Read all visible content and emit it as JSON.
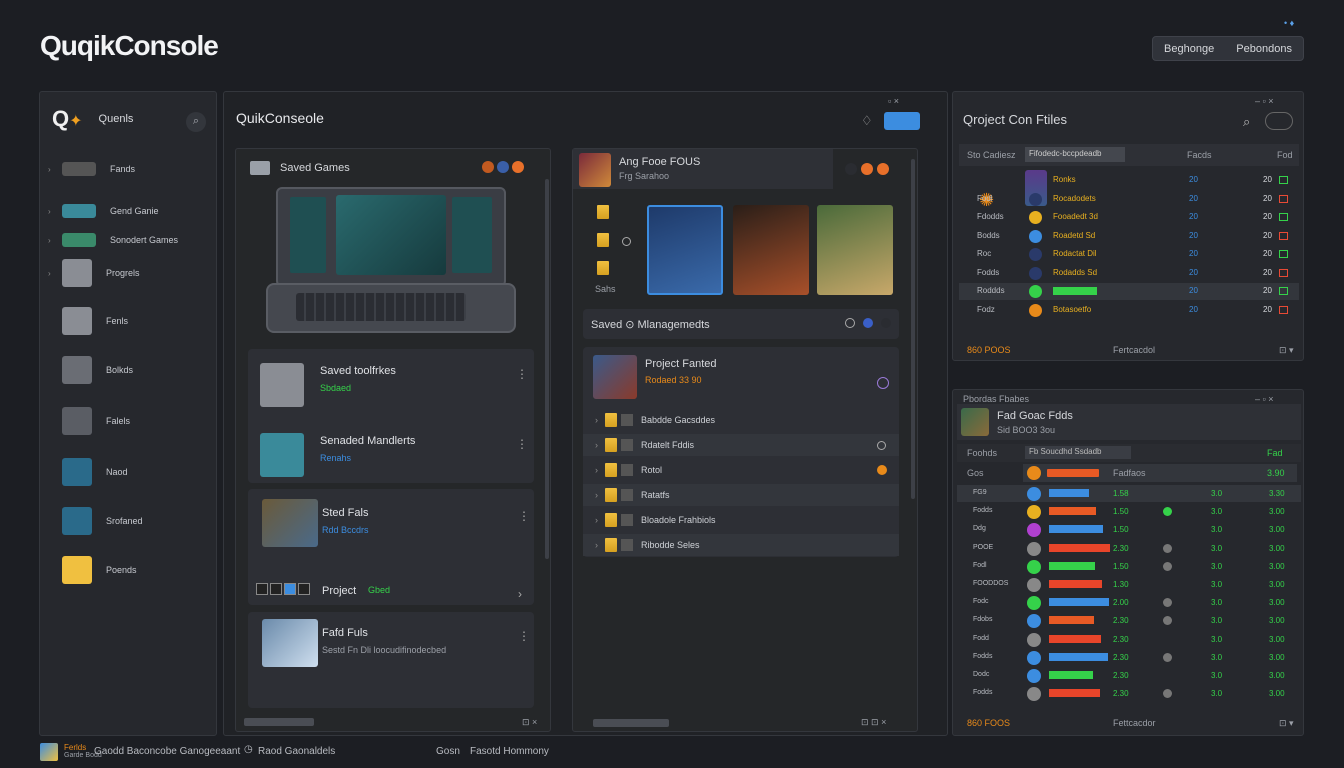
{
  "app": {
    "logo": "QuqikConsole",
    "top_btn1": "Beghonge",
    "top_btn2": "Pebondons",
    "tiny_top": "• ♦"
  },
  "sidebar": {
    "title": "Quenls",
    "items": [
      {
        "label": "Fands"
      },
      {
        "label": "Gend Ganie"
      },
      {
        "label": "Sonodert Games"
      },
      {
        "label": "Progrels"
      },
      {
        "label": "Fenls"
      },
      {
        "label": "Bolkds"
      },
      {
        "label": "Falels"
      },
      {
        "label": "Naod"
      },
      {
        "label": "Srofaned"
      },
      {
        "label": "Poends"
      }
    ]
  },
  "main": {
    "title": "QuikConseole",
    "win_controls": "▫ ×",
    "saved_games": {
      "title": "Saved Games"
    },
    "list": [
      {
        "title": "Saved toolfrkes",
        "sub": "Sbdaed"
      },
      {
        "title": "Senaded Mandlerts",
        "sub": "Renahs"
      },
      {
        "title": "Sted Fals",
        "sub": "Rdd Bccdrs"
      },
      {
        "title": "Project",
        "sub": "Gbed"
      },
      {
        "title": "Fafd Fuls",
        "sub": "Sestd Fn Dli loocudifinodecbed"
      }
    ],
    "footer_icons": "⊡ ×"
  },
  "middle": {
    "header_title": "Ang Fooe FOUS",
    "header_sub": "Frg Sarahoo",
    "folder_label": "Sahs",
    "management": {
      "title": "Saved ⊙ Mlanagemedts"
    },
    "project": {
      "title": "Project Fanted",
      "sub": "Rodaed 33 90"
    },
    "tree": [
      {
        "label": "Babdde Gacsddes"
      },
      {
        "label": "Rdatelt Fddis"
      },
      {
        "label": "Rotol"
      },
      {
        "label": "Ratatfs"
      },
      {
        "label": "Bloadole Frahbiols"
      },
      {
        "label": "Ribodde Seles"
      }
    ],
    "footer_icons": "⊡ ⊡ ×"
  },
  "right_top": {
    "title": "Qroject Con Ftiles",
    "win_controls": "– ▫ ×",
    "search_label": "Sto Cadiesz",
    "search_value": "Fifodedc-bccpdeadb",
    "col_header": "Facds",
    "col_header2": "Fod",
    "rows": [
      {
        "name": "",
        "desc": "Ronks",
        "a": "20",
        "b": "20"
      },
      {
        "name": "Fodl",
        "desc": "Rocadodets",
        "a": "20",
        "b": "20"
      },
      {
        "name": "Fdodds",
        "desc": "Fooadedt 3d",
        "a": "20",
        "b": "20"
      },
      {
        "name": "Bodds",
        "desc": "Roadetd Sd",
        "a": "20",
        "b": "20"
      },
      {
        "name": "Roc",
        "desc": "Rodactat Dil",
        "a": "20",
        "b": "20"
      },
      {
        "name": "Fodds",
        "desc": "Rodadds Sd",
        "a": "20",
        "b": "20"
      },
      {
        "name": "Roddds",
        "desc": "",
        "a": "20",
        "b": "20"
      },
      {
        "name": "Fodz",
        "desc": "Botasoetfo",
        "a": "20",
        "b": "20"
      }
    ],
    "footer_left": "860 POOS",
    "footer_mid": "Fertcacdol"
  },
  "right_bottom": {
    "title_small": "Pbordas Fbabes",
    "win_controls": "– ▫ ×",
    "title": "Fad Goac Fdds",
    "sub": "Sid BOO3 3ou",
    "filter_label": "Foohds",
    "filter_value": "Fb Soucdhd Ssdadb",
    "filter_right": "Fad",
    "head_name": "Gos",
    "head_desc": "Fadfaos",
    "rows": [
      {
        "name": "FG9",
        "v1": "1.58",
        "v2": "3.0",
        "v3": "3.30",
        "bar": "#3c8de0"
      },
      {
        "name": "Fodds",
        "v1": "1.50",
        "v2": "3.0",
        "v3": "3.00",
        "bar": "#e85a25"
      },
      {
        "name": "Ddg",
        "v1": "1.50",
        "v2": "3.0",
        "v3": "3.00",
        "bar": "#3c8de0"
      },
      {
        "name": "POOE",
        "v1": "2.30",
        "v2": "3.0",
        "v3": "3.00",
        "bar": "#e8452a"
      },
      {
        "name": "Fodl",
        "v1": "1.50",
        "v2": "3.0",
        "v3": "3.00",
        "bar": "#35d24a"
      },
      {
        "name": "FOODDOS",
        "v1": "1.30",
        "v2": "3.0",
        "v3": "3.00",
        "bar": "#e8452a"
      },
      {
        "name": "Fodc",
        "v1": "2.00",
        "v2": "3.0",
        "v3": "3.00",
        "bar": "#3c8de0"
      },
      {
        "name": "Fdobs",
        "v1": "2.30",
        "v2": "3.0",
        "v3": "3.00",
        "bar": "#e85a25"
      },
      {
        "name": "Fodd",
        "v1": "2.30",
        "v2": "3.0",
        "v3": "3.00",
        "bar": "#e8452a"
      },
      {
        "name": "Fodds",
        "v1": "2.30",
        "v2": "3.0",
        "v3": "3.00",
        "bar": "#3c8de0"
      },
      {
        "name": "Dodc",
        "v1": "2.30",
        "v2": "3.0",
        "v3": "3.00",
        "bar": "#35d24a"
      },
      {
        "name": "Fodds",
        "v1": "2.30",
        "v2": "3.0",
        "v3": "3.00",
        "bar": "#e8452a"
      }
    ],
    "footer_left": "860 FOOS",
    "footer_mid": "Fettcacdor"
  },
  "statusbar": {
    "item1": "Ferlds",
    "item1b": "Garde Bodd",
    "item2": "Gaodd Baconcobe Ganogeeaant",
    "item3": "Raod Gaonaldels",
    "item4": "Gosn",
    "item5": "Fasotd Hommony"
  },
  "colors": {
    "accent": "#3c8de0",
    "green": "#35d24a",
    "orange": "#e88a1a",
    "background": "#1c1e23"
  }
}
